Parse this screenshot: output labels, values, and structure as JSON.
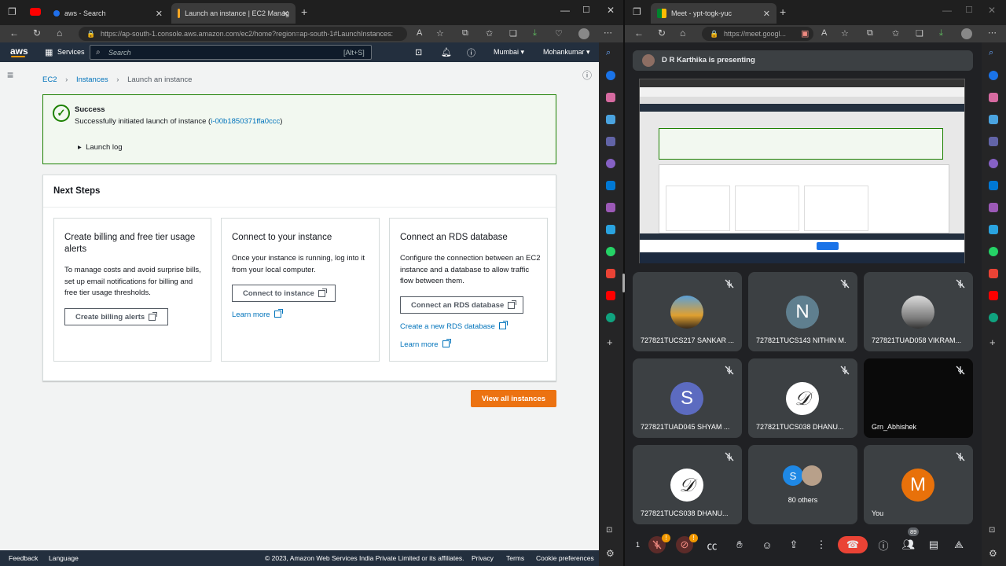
{
  "left": {
    "tabs": [
      {
        "title": "aws - Search"
      },
      {
        "title": "Launch an instance | EC2 Manag"
      }
    ],
    "url": "https://ap-south-1.console.aws.amazon.com/ec2/home?region=ap-south-1#LaunchInstances:",
    "aws": {
      "logo": "aws",
      "services": "Services",
      "search_placeholder": "Search",
      "shortcut": "[Alt+S]",
      "region": "Mumbai ▾",
      "user": "Mohankumar ▾"
    },
    "breadcrumb": [
      "EC2",
      "Instances",
      "Launch an instance"
    ],
    "flash": {
      "title": "Success",
      "text": "Successfully initiated launch of instance (",
      "instance_id": "i-00b1850371ffa0ccc",
      "close": ")",
      "log": "Launch log"
    },
    "next_steps": {
      "title": "Next Steps",
      "cards": [
        {
          "title": "Create billing and free tier usage alerts",
          "body": "To manage costs and avoid surprise bills, set up email notifications for billing and free tier usage thresholds.",
          "button": "Create billing alerts"
        },
        {
          "title": "Connect to your instance",
          "body": "Once your instance is running, log into it from your local computer.",
          "button": "Connect to instance",
          "link": "Learn more"
        },
        {
          "title": "Connect an RDS database",
          "body": "Configure the connection between an EC2 instance and a database to allow traffic flow between them.",
          "button": "Connect an RDS database",
          "link1": "Create a new RDS database",
          "link2": "Learn more"
        }
      ]
    },
    "view_all": "View all instances",
    "footer": {
      "feedback": "Feedback",
      "language": "Language",
      "copyright": "© 2023, Amazon Web Services India Private Limited or its affiliates.",
      "privacy": "Privacy",
      "terms": "Terms",
      "cookie": "Cookie preferences"
    }
  },
  "right": {
    "tab": "Meet - ypt-togk-yuc",
    "url": "https://meet.googl...",
    "presenter": "D R Karthika is presenting",
    "participants": [
      {
        "name": "727821TUCS217 SANKAR ...",
        "type": "photo"
      },
      {
        "name": "727821TUCS143 NITHIN M.",
        "initial": "N",
        "color": "#5f7f8f"
      },
      {
        "name": "727821TUAD058 VIKRAM...",
        "type": "photo2"
      },
      {
        "name": "727821TUAD045 SHYAM ...",
        "initial": "S",
        "color": "#5c6bc0"
      },
      {
        "name": "727821TUCS038 DHANU...",
        "type": "logo"
      },
      {
        "name": "Grn_Abhishek",
        "type": "dark"
      },
      {
        "name": "727821TUCS038 DHANU...",
        "type": "logo"
      },
      {
        "name": "80 others",
        "type": "others"
      },
      {
        "name": "You",
        "initial": "M",
        "color": "#e8710a"
      }
    ],
    "badge_count": "89",
    "mic_badge": "!",
    "others_initial": "S"
  },
  "colors": {
    "aws_orange": "#ec7211",
    "aws_nav": "#232f3e",
    "success": "#1d8102",
    "link": "#0073bb",
    "meet_bg": "#202124",
    "meet_tile": "#3c4043",
    "end_call": "#ea4335"
  }
}
